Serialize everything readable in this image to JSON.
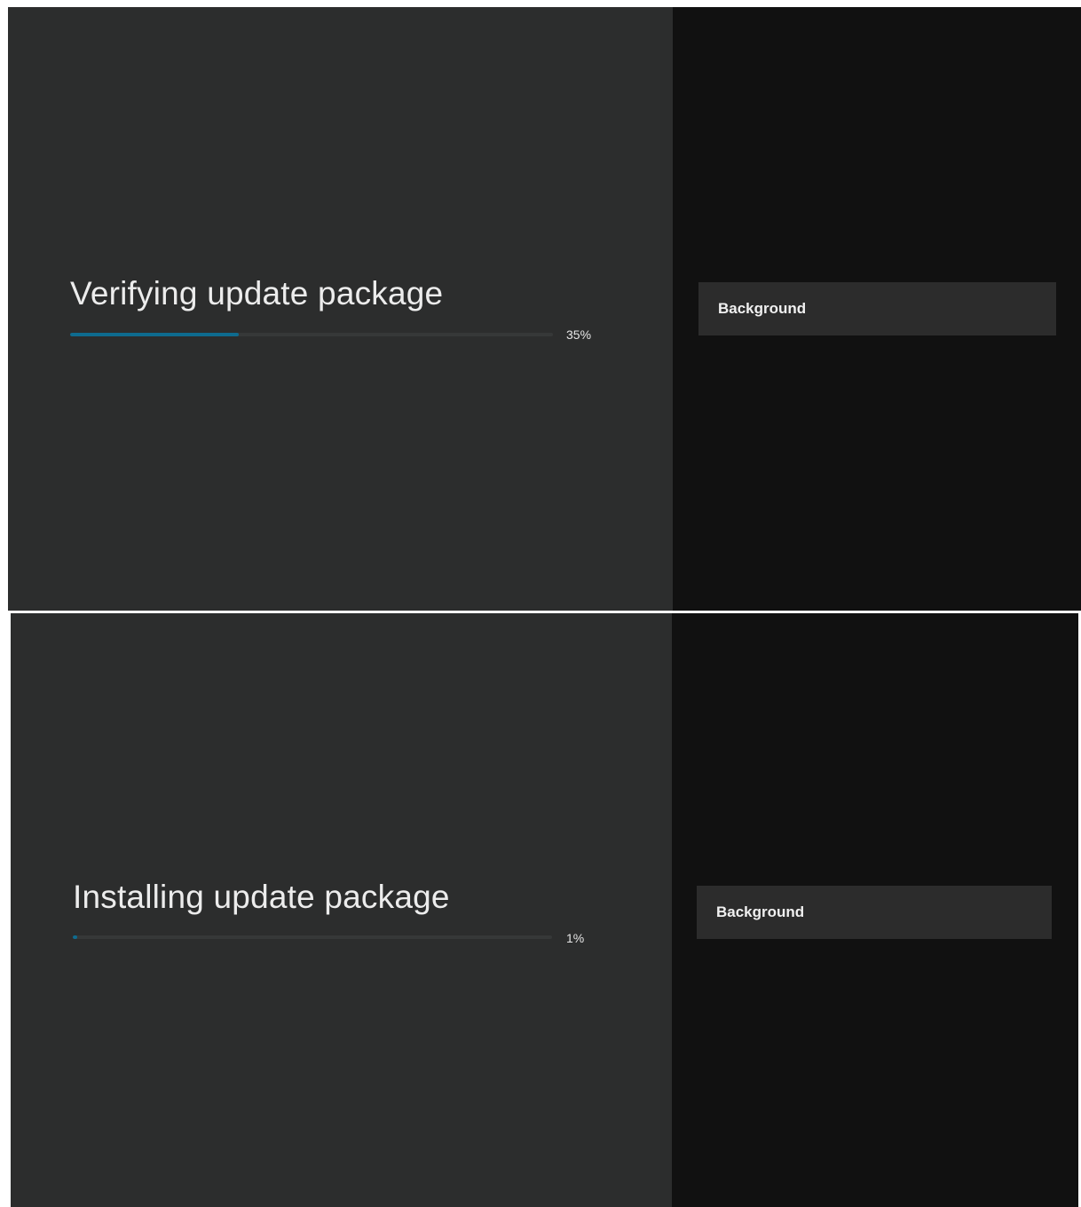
{
  "screens": [
    {
      "title": "Verifying update package",
      "progress_percent": 35,
      "progress_label": "35%",
      "side_option_label": "Background"
    },
    {
      "title": "Installing update package",
      "progress_percent": 1,
      "progress_label": "1%",
      "side_option_label": "Background"
    }
  ],
  "colors": {
    "main_panel_bg": "#2c2d2d",
    "side_panel_bg": "#111111",
    "progress_accent": "#0e6b8f",
    "progress_track": "#363838"
  }
}
